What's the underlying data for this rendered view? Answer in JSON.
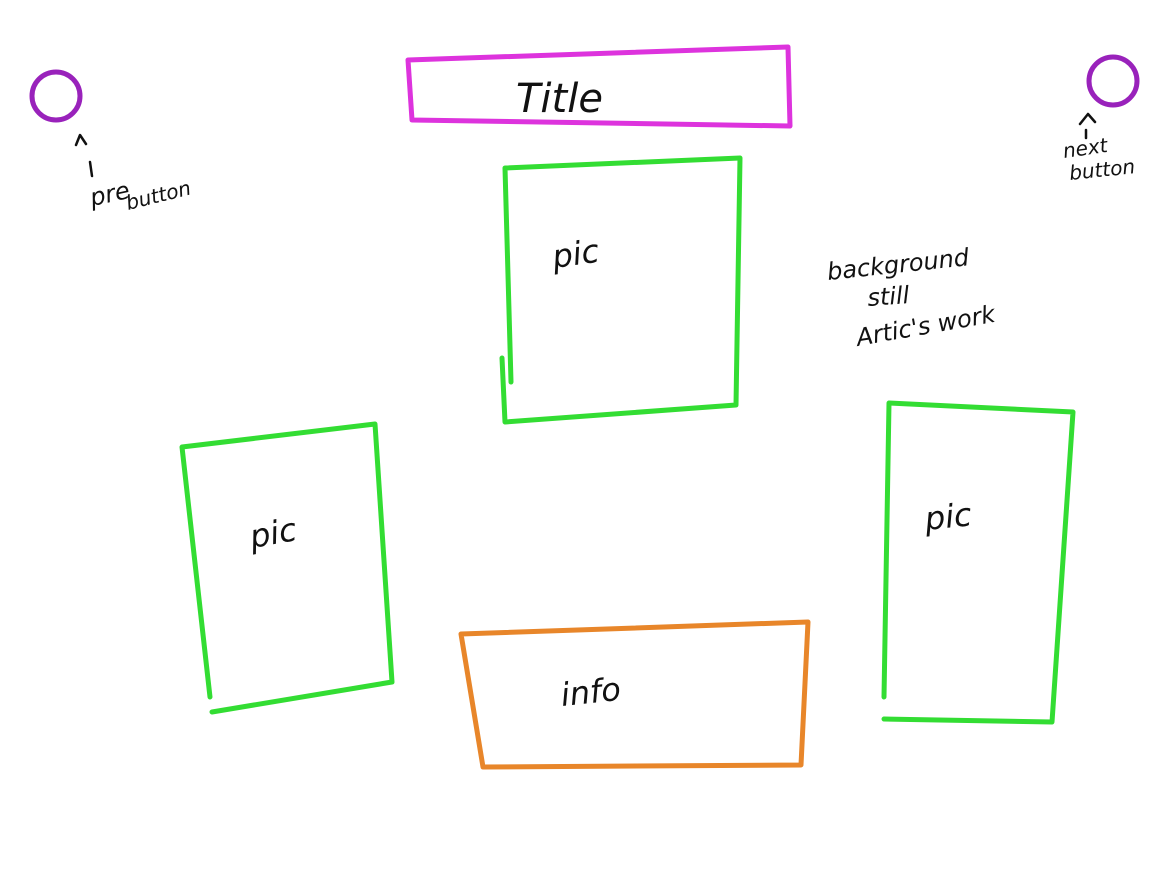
{
  "colors": {
    "title_box": "#dd33dd",
    "pic_box": "#33dd33",
    "info_box": "#e8862a",
    "button_circle": "#9922bb",
    "ink": "#111111"
  },
  "title_box": {
    "label": "Title"
  },
  "pic_boxes": [
    {
      "label": "pic"
    },
    {
      "label": "pic"
    },
    {
      "label": "pic"
    }
  ],
  "info_box": {
    "label": "info"
  },
  "prev_button": {
    "note_line1": "pre",
    "note_line2": "button"
  },
  "next_button": {
    "note_line1": "next",
    "note_line2": "button"
  },
  "background_note": {
    "line1": "background",
    "line2": "still",
    "line3": "Artic's work"
  }
}
